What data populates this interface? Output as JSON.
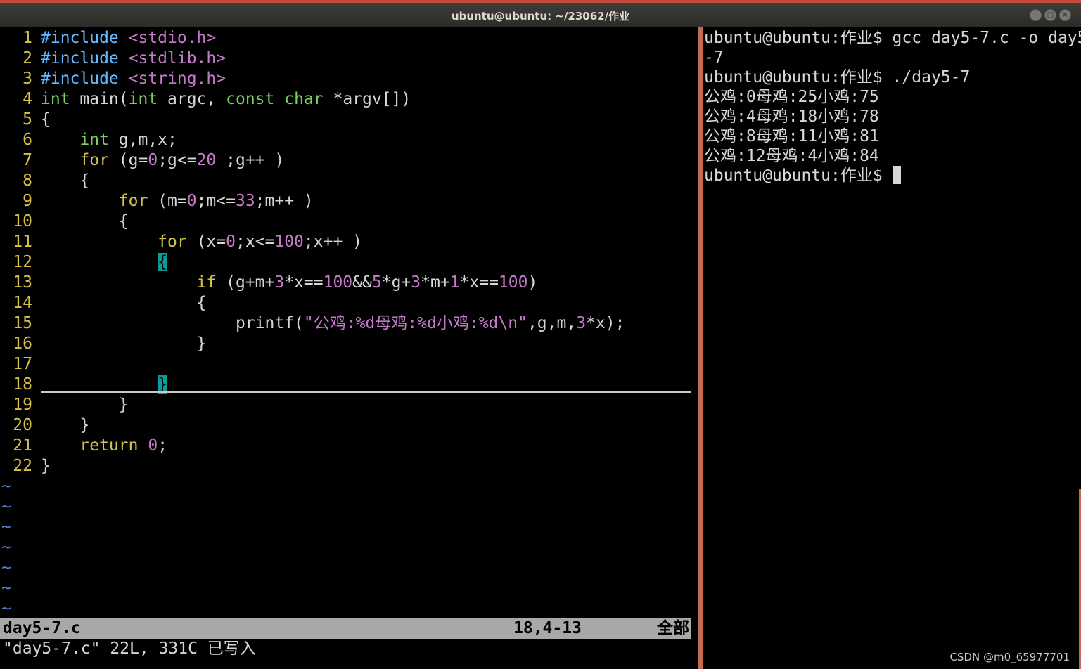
{
  "window": {
    "title": "ubuntu@ubuntu: ~/23062/作业",
    "controls": [
      "–",
      "□",
      "×"
    ]
  },
  "vim": {
    "lines": [
      {
        "n": "1",
        "segs": [
          [
            "kw-pp",
            "#include "
          ],
          [
            "str",
            "<stdio.h>"
          ]
        ]
      },
      {
        "n": "2",
        "segs": [
          [
            "kw-pp",
            "#include "
          ],
          [
            "str",
            "<stdlib.h>"
          ]
        ]
      },
      {
        "n": "3",
        "segs": [
          [
            "kw-pp",
            "#include "
          ],
          [
            "str",
            "<string.h>"
          ]
        ]
      },
      {
        "n": "4",
        "segs": [
          [
            "kw-ty",
            "int"
          ],
          [
            "op",
            " main("
          ],
          [
            "kw-ty",
            "int"
          ],
          [
            "op",
            " argc, "
          ],
          [
            "kw-ty",
            "const"
          ],
          [
            "op",
            " "
          ],
          [
            "kw-ty",
            "char"
          ],
          [
            "op",
            " *argv[])"
          ]
        ]
      },
      {
        "n": "5",
        "segs": [
          [
            "op",
            "{"
          ]
        ]
      },
      {
        "n": "6",
        "segs": [
          [
            "op",
            "    "
          ],
          [
            "kw-ty",
            "int"
          ],
          [
            "op",
            " g,m,x;"
          ]
        ]
      },
      {
        "n": "7",
        "segs": [
          [
            "op",
            "    "
          ],
          [
            "kw-st",
            "for"
          ],
          [
            "op",
            " (g="
          ],
          [
            "num",
            "0"
          ],
          [
            "op",
            ";g<="
          ],
          [
            "num",
            "20"
          ],
          [
            "op",
            " ;g++ )"
          ]
        ]
      },
      {
        "n": "8",
        "segs": [
          [
            "op",
            "    {"
          ]
        ]
      },
      {
        "n": "9",
        "segs": [
          [
            "op",
            "        "
          ],
          [
            "kw-st",
            "for"
          ],
          [
            "op",
            " (m="
          ],
          [
            "num",
            "0"
          ],
          [
            "op",
            ";m<="
          ],
          [
            "num",
            "33"
          ],
          [
            "op",
            ";m++ )"
          ]
        ]
      },
      {
        "n": "10",
        "segs": [
          [
            "op",
            "        {"
          ]
        ]
      },
      {
        "n": "11",
        "segs": [
          [
            "op",
            "            "
          ],
          [
            "kw-st",
            "for"
          ],
          [
            "op",
            " (x="
          ],
          [
            "num",
            "0"
          ],
          [
            "op",
            ";x<="
          ],
          [
            "num",
            "100"
          ],
          [
            "op",
            ";x++ )"
          ]
        ]
      },
      {
        "n": "12",
        "segs": [
          [
            "op",
            "            "
          ],
          [
            "hl-brace",
            "{"
          ]
        ]
      },
      {
        "n": "13",
        "segs": [
          [
            "op",
            "                "
          ],
          [
            "kw-st",
            "if"
          ],
          [
            "op",
            " (g+m+"
          ],
          [
            "num",
            "3"
          ],
          [
            "op",
            "*x=="
          ],
          [
            "num",
            "100"
          ],
          [
            "op",
            "&&"
          ],
          [
            "num",
            "5"
          ],
          [
            "op",
            "*g+"
          ],
          [
            "num",
            "3"
          ],
          [
            "op",
            "*m+"
          ],
          [
            "num",
            "1"
          ],
          [
            "op",
            "*x=="
          ],
          [
            "num",
            "100"
          ],
          [
            "op",
            ")"
          ]
        ]
      },
      {
        "n": "14",
        "segs": [
          [
            "op",
            "                {"
          ]
        ]
      },
      {
        "n": "15",
        "segs": [
          [
            "op",
            "                    printf("
          ],
          [
            "str",
            "\"公鸡:"
          ],
          [
            "sp",
            "%d"
          ],
          [
            "str",
            "母鸡:"
          ],
          [
            "sp",
            "%d"
          ],
          [
            "str",
            "小鸡:"
          ],
          [
            "sp",
            "%d"
          ],
          [
            "str",
            "\\n\""
          ],
          [
            "op",
            ",g,m,"
          ],
          [
            "num",
            "3"
          ],
          [
            "op",
            "*x);"
          ]
        ]
      },
      {
        "n": "16",
        "segs": [
          [
            "op",
            "                }"
          ]
        ]
      },
      {
        "n": "17",
        "segs": [
          [
            "op",
            ""
          ]
        ]
      },
      {
        "n": "18",
        "segs": [
          [
            "op",
            "            "
          ],
          [
            "hl-brace",
            "}"
          ]
        ]
      },
      {
        "n": "19",
        "segs": [
          [
            "op",
            "        }"
          ]
        ]
      },
      {
        "n": "20",
        "segs": [
          [
            "op",
            "    }"
          ]
        ]
      },
      {
        "n": "21",
        "segs": [
          [
            "op",
            "    "
          ],
          [
            "kw-st",
            "return"
          ],
          [
            "op",
            " "
          ],
          [
            "num",
            "0"
          ],
          [
            "op",
            ";"
          ]
        ]
      },
      {
        "n": "22",
        "segs": [
          [
            "op",
            "}"
          ]
        ]
      }
    ],
    "tilde_count": 7,
    "tilde": "~",
    "status": {
      "file": "day5-7.c",
      "position": "18,4-13",
      "scroll": "全部"
    },
    "message": "\"day5-7.c\" 22L, 331C 已写入"
  },
  "terminal": {
    "lines": [
      "ubuntu@ubuntu:作业$ gcc day5-7.c -o day5",
      "-7",
      "ubuntu@ubuntu:作业$ ./day5-7",
      "公鸡:0母鸡:25小鸡:75",
      "公鸡:4母鸡:18小鸡:78",
      "公鸡:8母鸡:11小鸡:81",
      "公鸡:12母鸡:4小鸡:84"
    ],
    "prompt": "ubuntu@ubuntu:作业$ "
  },
  "watermark": "CSDN @m0_65977701",
  "colors": {
    "accent": "#c56a4e",
    "line_number": "#d6c146",
    "preprocessor": "#63b8ff",
    "type": "#7bcf5f",
    "statement": "#d3c24b",
    "string": "#c57ac9",
    "match_paren": "#0c9a9a"
  }
}
